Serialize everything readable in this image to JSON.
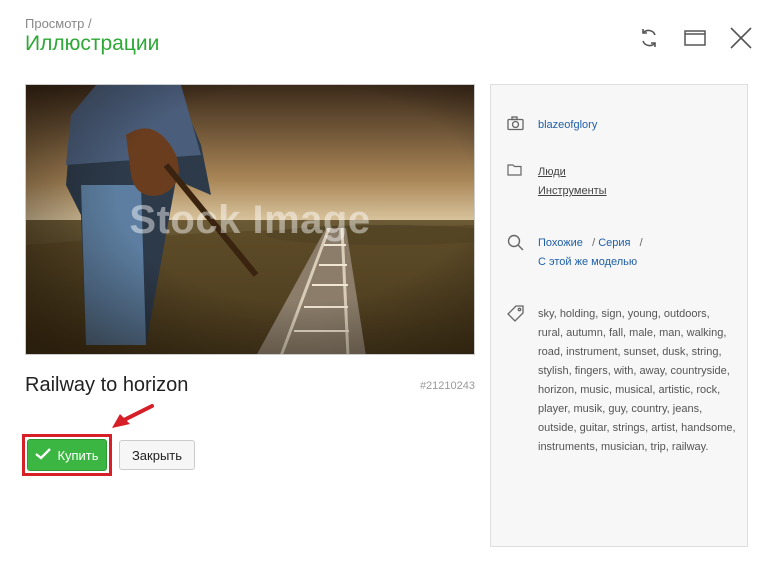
{
  "header": {
    "breadcrumb": "Просмотр /",
    "title": "Иллюстрации"
  },
  "icons": {
    "refresh": "refresh-icon",
    "window": "window-icon",
    "close": "close-icon"
  },
  "image": {
    "watermark": "Stock Image",
    "title": "Railway to horizon",
    "id": "#21210243"
  },
  "buttons": {
    "buy": "Купить",
    "close": "Закрыть"
  },
  "panel": {
    "author": "blazeofglory",
    "categories": [
      "Люди",
      "Инструменты"
    ],
    "similar": {
      "similar_label": "Похожие",
      "series_label": "Серия",
      "separator": "/",
      "same_model_label": "С этой же моделью"
    },
    "tags": [
      "sky",
      "holding",
      "sign",
      "young",
      "outdoors",
      "rural",
      "autumn",
      "fall",
      "male",
      "man",
      "walking",
      "road",
      "instrument",
      "sunset",
      "dusk",
      "string",
      "stylish",
      "fingers",
      "with",
      "away",
      "countryside",
      "horizon",
      "music",
      "musical",
      "artistic",
      "rock",
      "player",
      "musik",
      "guy",
      "country",
      "jeans",
      "outside",
      "guitar",
      "strings",
      "artist",
      "handsome",
      "instruments",
      "musician",
      "trip",
      "railway"
    ]
  },
  "colors": {
    "accent_green": "#2ea836",
    "buy_button": "#3cb642",
    "highlight_red": "#d61f26",
    "link_blue": "#1f5fa6"
  }
}
